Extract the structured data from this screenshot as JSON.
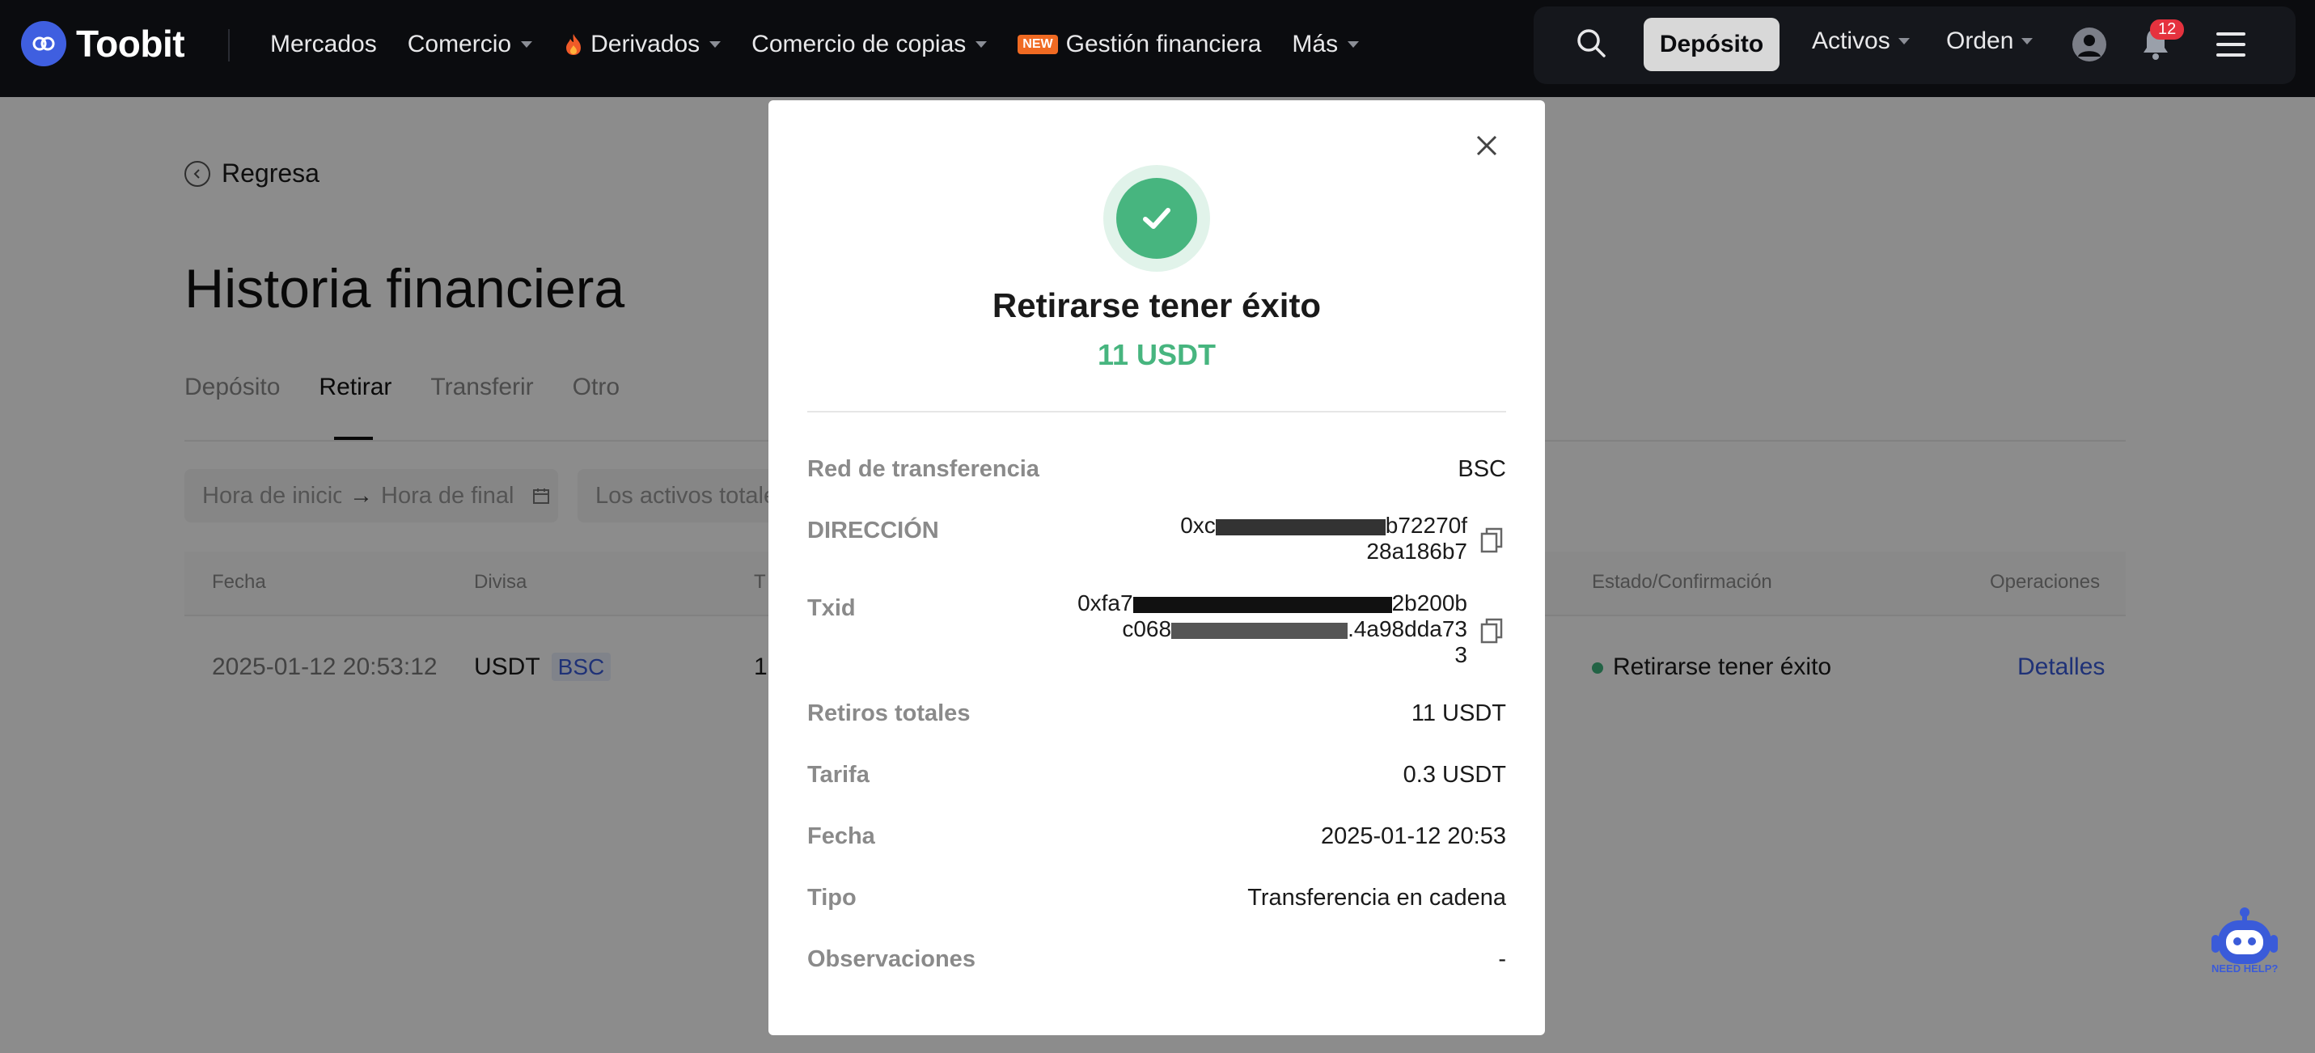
{
  "nav": {
    "brand": "Toobit",
    "links": [
      {
        "label": "Mercados",
        "caret": false
      },
      {
        "label": "Comercio",
        "caret": true
      },
      {
        "label": "Derivados",
        "caret": true,
        "icon": "fire-icon"
      },
      {
        "label": "Comercio de copias",
        "caret": true
      },
      {
        "label": "Gestión financiera",
        "badge": "NEW"
      },
      {
        "label": "Más",
        "caret": true
      }
    ],
    "deposit_button": "Depósito",
    "assets": "Activos",
    "order": "Orden",
    "notification_count": "12"
  },
  "page": {
    "back_label": "Regresa",
    "title": "Historia financiera",
    "tabs": [
      "Depósito",
      "Retirar",
      "Transferir",
      "Otro"
    ],
    "active_tab": "Retirar",
    "filters": {
      "start_placeholder": "Hora de inicio",
      "end_placeholder": "Hora de final",
      "asset_placeholder": "Los activos totales"
    },
    "table": {
      "headers": {
        "date": "Fecha",
        "currency": "Divisa",
        "col3": "T",
        "status": "Estado/Confirmación",
        "ops": "Operaciones"
      },
      "rows": [
        {
          "date": "2025-01-12 20:53:12",
          "currency": "USDT",
          "network": "BSC",
          "amount_partial": "1",
          "status": "Retirarse tener éxito",
          "action": "Detalles"
        }
      ]
    }
  },
  "modal": {
    "title": "Retirarse tener éxito",
    "amount": "11 USDT",
    "rows": {
      "network": {
        "label": "Red de transferencia",
        "value": "BSC"
      },
      "address": {
        "label": "DIRECCIÓN",
        "line1": "0xc",
        "line1_tail": "b72270f",
        "line2": "28a186b7"
      },
      "txid": {
        "label": "Txid",
        "line1": "0xfa7",
        "line1_tail": "2b200b",
        "line2": "c068",
        "line2_tail": ".4a98dda73",
        "line3": "3"
      },
      "total": {
        "label": "Retiros totales",
        "value": "11 USDT"
      },
      "fee": {
        "label": "Tarifa",
        "value": "0.3 USDT"
      },
      "date": {
        "label": "Fecha",
        "value": "2025-01-12 20:53"
      },
      "type": {
        "label": "Tipo",
        "value": "Transferencia en cadena"
      },
      "notes": {
        "label": "Observaciones",
        "value": "-"
      }
    }
  },
  "help": {
    "label": "NEED HELP?"
  },
  "colors": {
    "accent_green": "#47b57f",
    "link_blue": "#3a5bd9",
    "nav_bg": "#0b0c0f"
  }
}
